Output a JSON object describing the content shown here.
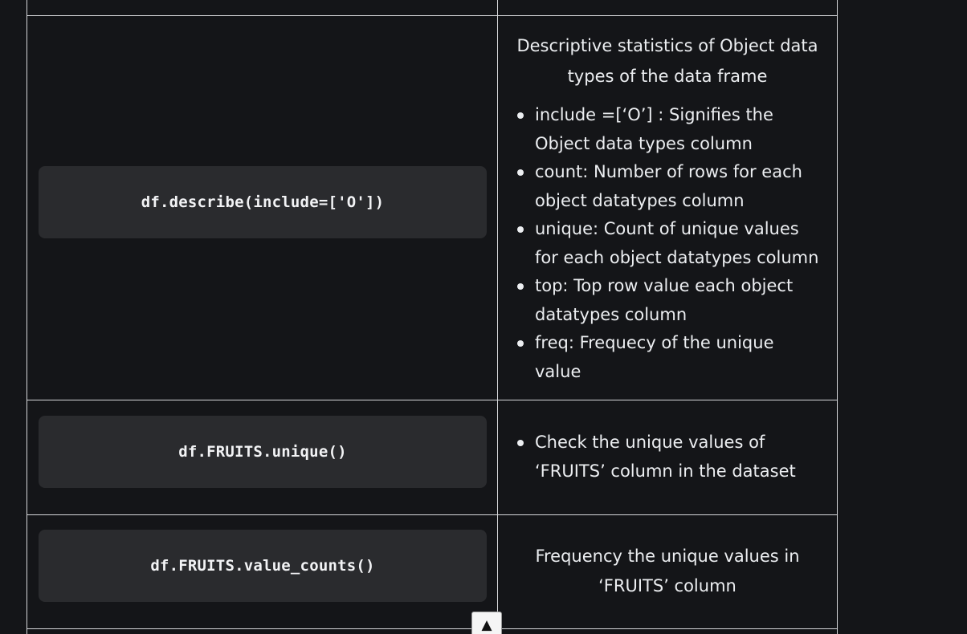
{
  "rows": [
    {
      "code": "df.describe(include=['O'])",
      "intro": "Descriptive statistics of Object data types of the data frame",
      "bullets": [
        "include =[‘O’] : Signifies the Object data types column",
        "count: Number of rows for each object datatypes column",
        "unique: Count of unique values for each object datatypes column",
        "top: Top row value each object datatypes column",
        "freq: Frequecy of the unique value"
      ]
    },
    {
      "code": "df.FRUITS.unique()",
      "bullets": [
        "Check the unique values of ‘FRUITS’ column in the dataset"
      ]
    },
    {
      "code": "df.FRUITS.value_counts()",
      "intro": "Frequency the unique values in ‘FRUITS’ column"
    }
  ],
  "scroll_top": {
    "icon": "arrow-up-icon",
    "glyph": "▲"
  }
}
